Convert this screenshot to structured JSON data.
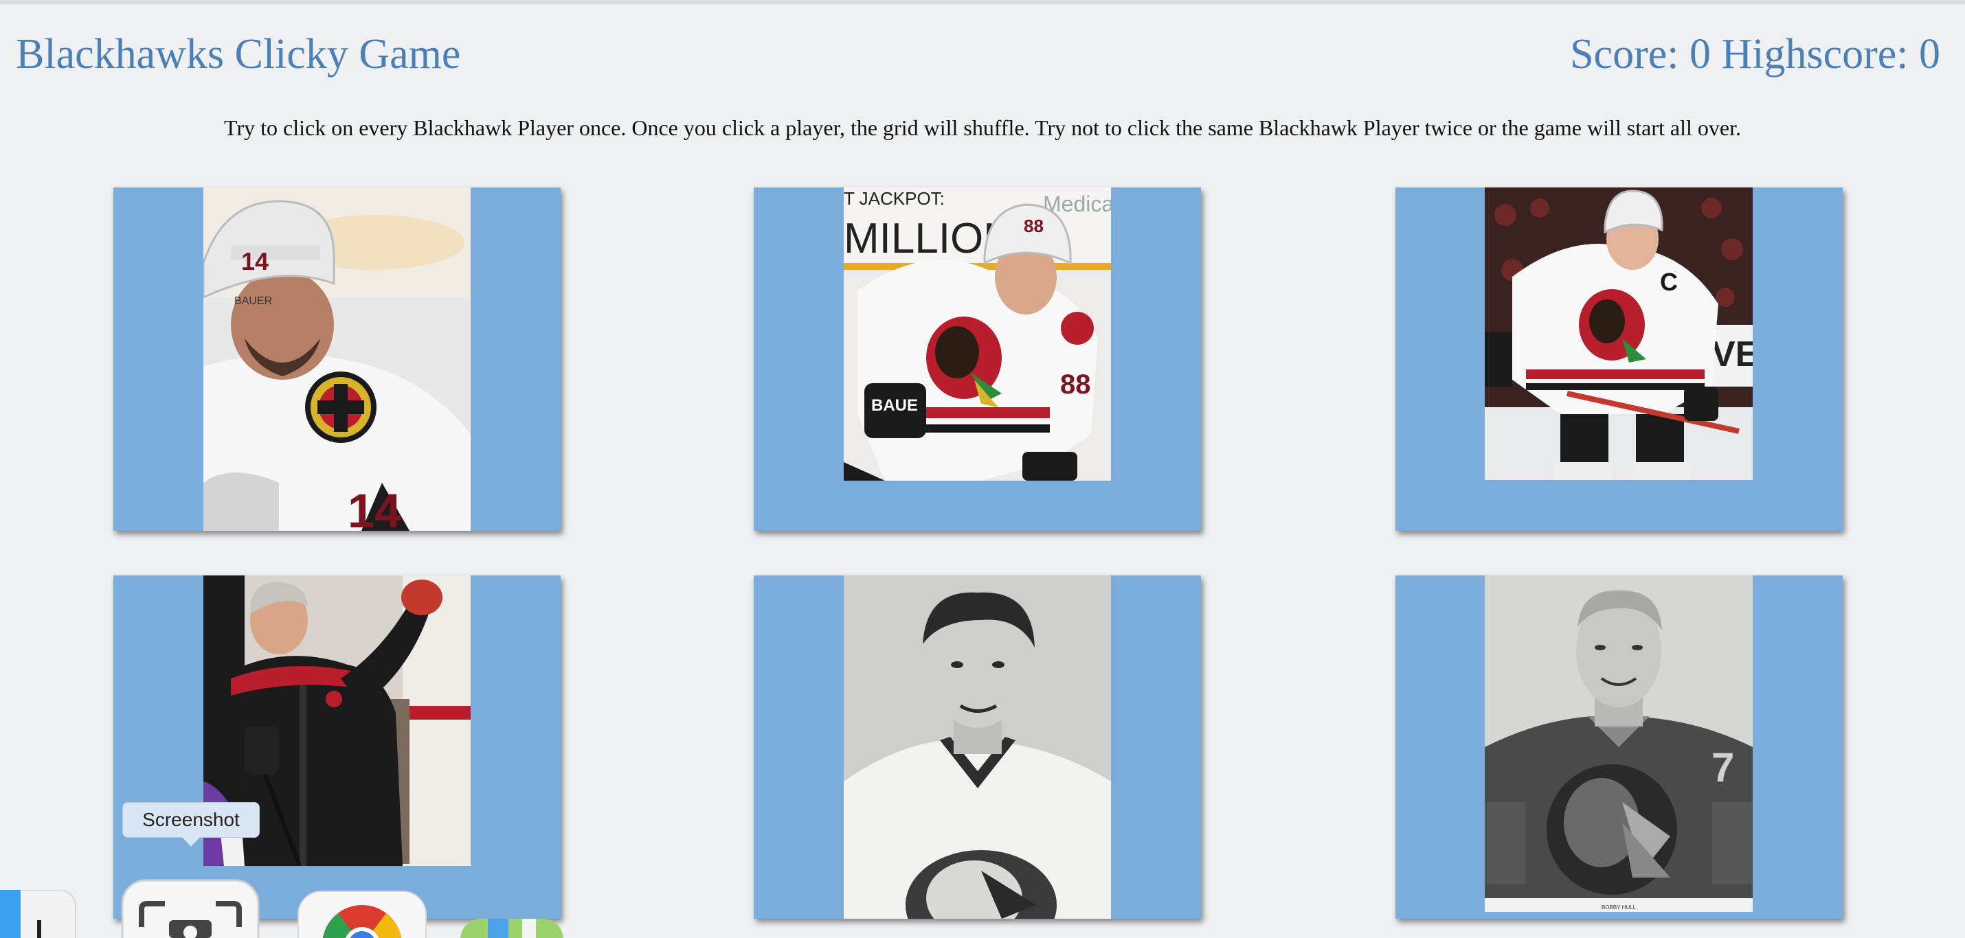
{
  "app": {
    "title": "Blackhawks Clicky Game",
    "score_text": "Score: 0 Highscore: 0",
    "score": 0,
    "highscore": 0
  },
  "instructions": "Try to click on every Blackhawk Player once. Once you click a player, the grid will shuffle. Try not to click the same Blackhawk Player twice or the game will start all over.",
  "players": [
    {
      "name": "player-14"
    },
    {
      "name": "player-88"
    },
    {
      "name": "player-captain-19"
    },
    {
      "name": "coach"
    },
    {
      "name": "vintage-player-1"
    },
    {
      "name": "vintage-player-bobby-hull",
      "caption": "BOBBY HULL"
    }
  ],
  "dock": {
    "tooltip": "Screenshot",
    "items": [
      {
        "icon": "finder-icon"
      },
      {
        "icon": "screenshot-icon"
      },
      {
        "icon": "chrome-icon"
      },
      {
        "icon": "maps-icon"
      }
    ]
  },
  "colors": {
    "accent": "#4a80b6",
    "card": "#7aaddb",
    "background": "#eff0f2"
  }
}
